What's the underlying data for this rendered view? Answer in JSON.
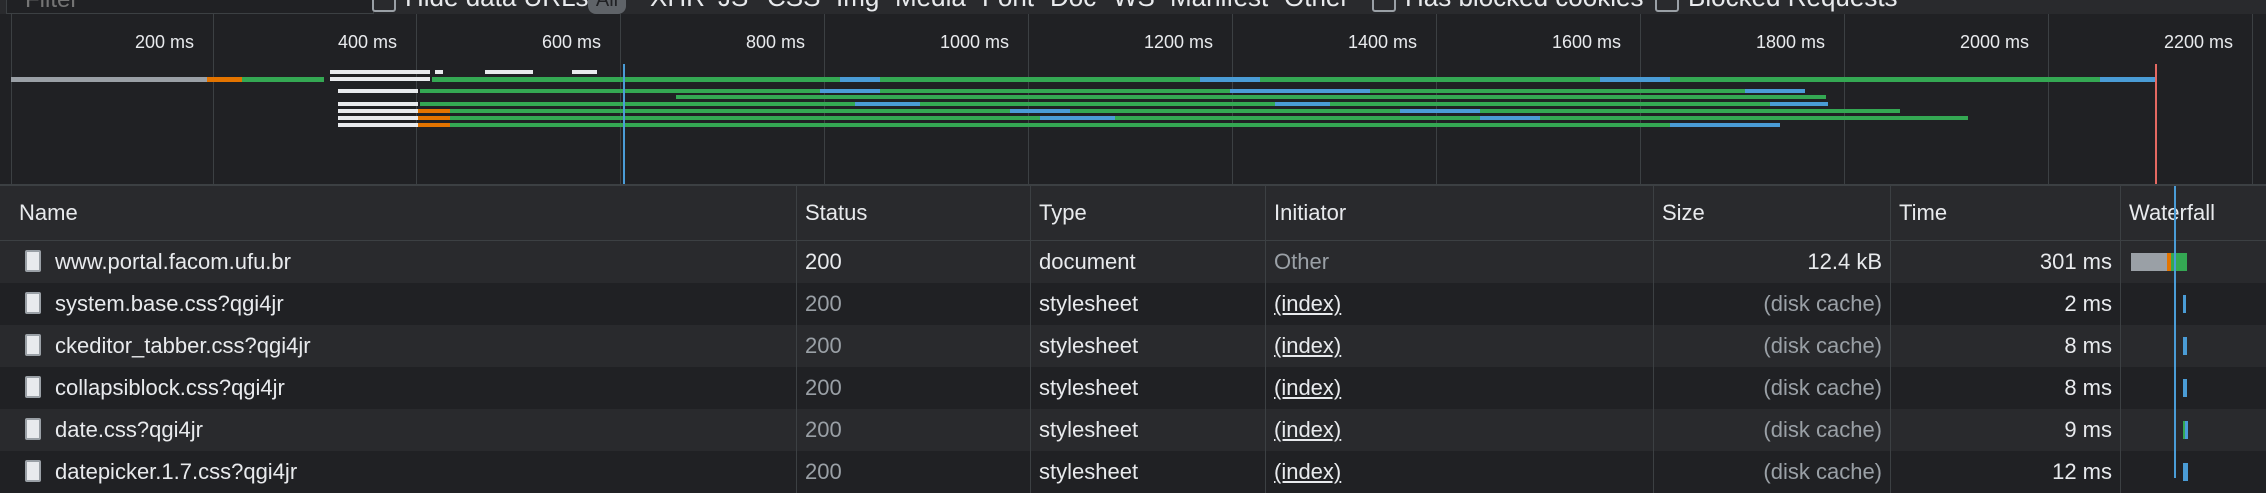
{
  "filter_bar": {
    "filter_placeholder": "Filter",
    "hide_data_urls": "Hide data URLs",
    "all_label": "All",
    "types": [
      "XHR",
      "JS",
      "CSS",
      "Img",
      "Media",
      "Font",
      "Doc",
      "WS",
      "Manifest",
      "Other"
    ],
    "blocked_cookies": "Has blocked cookies",
    "blocked_requests": "Blocked Requests"
  },
  "overview": {
    "ticks": [
      "200 ms",
      "400 ms",
      "600 ms",
      "800 ms",
      "1000 ms",
      "1200 ms",
      "1400 ms",
      "1600 ms",
      "1800 ms",
      "2000 ms",
      "2200 ms"
    ]
  },
  "table": {
    "columns": [
      "Name",
      "Status",
      "Type",
      "Initiator",
      "Size",
      "Time",
      "Waterfall"
    ],
    "rows": [
      {
        "name": "www.portal.facom.ufu.br",
        "status": "200",
        "type": "document",
        "initiator": "Other",
        "size": "12.4 kB",
        "time": "301 ms"
      },
      {
        "name": "system.base.css?qgi4jr",
        "status": "200",
        "type": "stylesheet",
        "initiator": "(index)",
        "size": "(disk cache)",
        "time": "2 ms"
      },
      {
        "name": "ckeditor_tabber.css?qgi4jr",
        "status": "200",
        "type": "stylesheet",
        "initiator": "(index)",
        "size": "(disk cache)",
        "time": "8 ms"
      },
      {
        "name": "collapsiblock.css?qgi4jr",
        "status": "200",
        "type": "stylesheet",
        "initiator": "(index)",
        "size": "(disk cache)",
        "time": "8 ms"
      },
      {
        "name": "date.css?qgi4jr",
        "status": "200",
        "type": "stylesheet",
        "initiator": "(index)",
        "size": "(disk cache)",
        "time": "9 ms"
      },
      {
        "name": "datepicker.1.7.css?qgi4jr",
        "status": "200",
        "type": "stylesheet",
        "initiator": "(index)",
        "size": "(disk cache)",
        "time": "12 ms"
      }
    ]
  },
  "colors": {
    "background": "#202124",
    "row_alt": "#292a2d",
    "waiting_green": "#34a853",
    "download_blue": "#4a9cd6",
    "dns_orange": "#e37400",
    "load_red": "#e46962"
  }
}
